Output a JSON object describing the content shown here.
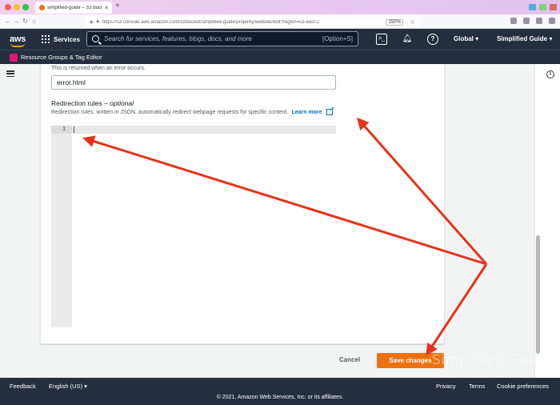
{
  "browser": {
    "tab_title": "simplified-guide – S3 bucket",
    "url": "https://s3.console.aws.amazon.com/s3/bucket/simplified-guide/property/website/edit?region=us-east-2",
    "zoom": "150%"
  },
  "aws_nav": {
    "logo": "aws",
    "services_label": "Services",
    "search_placeholder": "Search for services, features, blogs, docs, and more",
    "search_shortcut": "[Option+S]",
    "region": "Global ▾",
    "account": "Simplified Guide ▾"
  },
  "resource_bar": {
    "label": "Resource Groups & Tag Editor"
  },
  "form": {
    "error_doc_desc": "This is returned when an error occurs.",
    "error_doc_value": "error.html",
    "redirection_label": "Redirection rules –",
    "redirection_optional": "optional",
    "redirection_desc": "Redirection rules, written in JSON, automatically redirect webpage requests for specific content.",
    "learn_more": "Learn more",
    "editor_line_number": "1"
  },
  "actions": {
    "cancel": "Cancel",
    "save": "Save changes"
  },
  "footer": {
    "feedback": "Feedback",
    "language": "English (US) ▾",
    "privacy": "Privacy",
    "terms": "Terms",
    "cookie": "Cookie preferences",
    "copyright": "© 2021, Amazon Web Services, Inc. or its affiliates."
  },
  "watermark": "Simplified Guide",
  "colors": {
    "aws_dark": "#232f3e",
    "aws_orange": "#ec7211",
    "link_blue": "#0073bb",
    "annotation_red": "#e8321a"
  }
}
